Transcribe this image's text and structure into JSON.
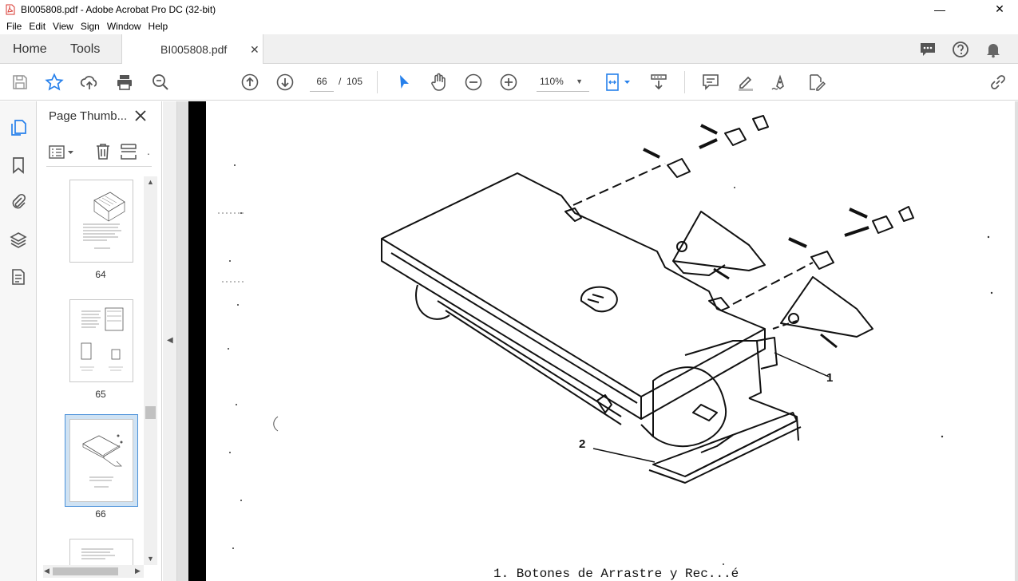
{
  "window": {
    "title": "BI005808.pdf - Adobe Acrobat Pro DC (32-bit)",
    "controls": {
      "minimize": "—",
      "close": "✕"
    }
  },
  "menu": [
    "File",
    "Edit",
    "View",
    "Sign",
    "Window",
    "Help"
  ],
  "tabs": {
    "home": "Home",
    "tools": "Tools",
    "document": "BI005808.pdf",
    "document_close": "✕"
  },
  "toolbar": {
    "current_page": "66",
    "page_separator": "/",
    "total_pages": "105",
    "zoom": "110%"
  },
  "icons": {
    "top_right": [
      "chat-icon",
      "help-icon",
      "bell-icon"
    ],
    "toolbar_left": [
      "save-icon",
      "star-icon",
      "upload-icon",
      "print-icon",
      "zoom-search-icon"
    ],
    "toolbar_nav": [
      "page-up-icon",
      "page-down-icon"
    ],
    "toolbar_tools": [
      "select-cursor-icon",
      "hand-icon",
      "zoom-out-icon",
      "zoom-in-icon",
      "fit-page-icon",
      "scroll-mode-icon",
      "comment-icon",
      "highlight-icon",
      "sign-icon",
      "edit-pdf-icon",
      "share-link-icon"
    ],
    "left_rail": [
      "page-thumbnails-icon",
      "bookmarks-icon",
      "attachments-icon",
      "layers-icon",
      "document-icon"
    ]
  },
  "thumbnail_panel": {
    "title": "Page Thumb...",
    "close": "✕",
    "thumbnails": [
      {
        "label": "64",
        "selected": false
      },
      {
        "label": "65",
        "selected": false
      },
      {
        "label": "66",
        "selected": true
      }
    ]
  },
  "document": {
    "callout_1": "1",
    "callout_2": "2",
    "caption": "1. Botones de Arrastre y Rec...é"
  },
  "colors": {
    "accent": "#2680eb",
    "selection": "#cfe2f3",
    "pdf_icon": "#d7332b"
  }
}
